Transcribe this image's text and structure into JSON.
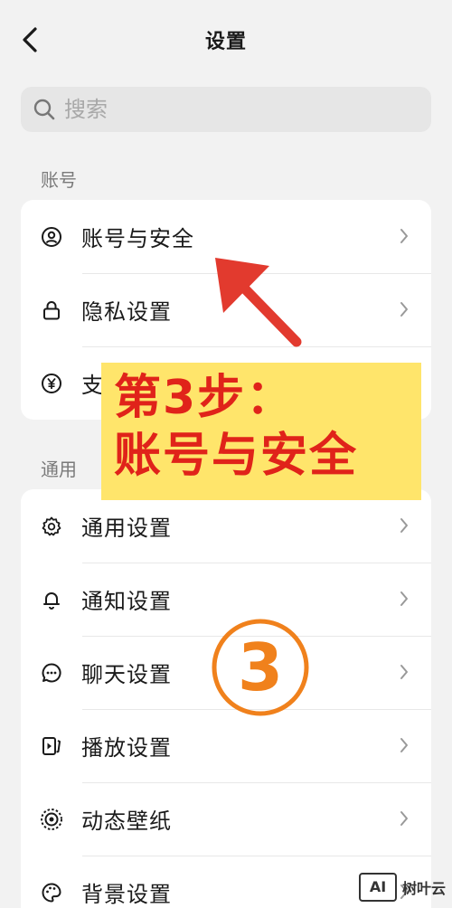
{
  "header": {
    "title": "设置"
  },
  "search": {
    "placeholder": "搜索"
  },
  "sections": {
    "account": {
      "title": "账号",
      "items": [
        {
          "label": "账号与安全",
          "icon": "user-circle-icon"
        },
        {
          "label": "隐私设置",
          "icon": "lock-icon"
        },
        {
          "label": "支",
          "icon": "yen-circle-icon"
        }
      ]
    },
    "general": {
      "title": "通用",
      "items": [
        {
          "label": "通用设置",
          "icon": "gear-icon"
        },
        {
          "label": "通知设置",
          "icon": "bell-icon"
        },
        {
          "label": "聊天设置",
          "icon": "chat-bubble-icon"
        },
        {
          "label": "播放设置",
          "icon": "play-device-icon"
        },
        {
          "label": "动态壁纸",
          "icon": "live-wallpaper-icon"
        },
        {
          "label": "背景设置",
          "icon": "palette-icon"
        }
      ]
    }
  },
  "overlay": {
    "line1": "第3步：",
    "line2": "账号与安全",
    "step_number": "3",
    "colors": {
      "text": "#e0231a",
      "box": "#ffe56b",
      "circle": "#f0811c"
    }
  },
  "watermark": {
    "logo": "AI",
    "text": "树叶云"
  }
}
